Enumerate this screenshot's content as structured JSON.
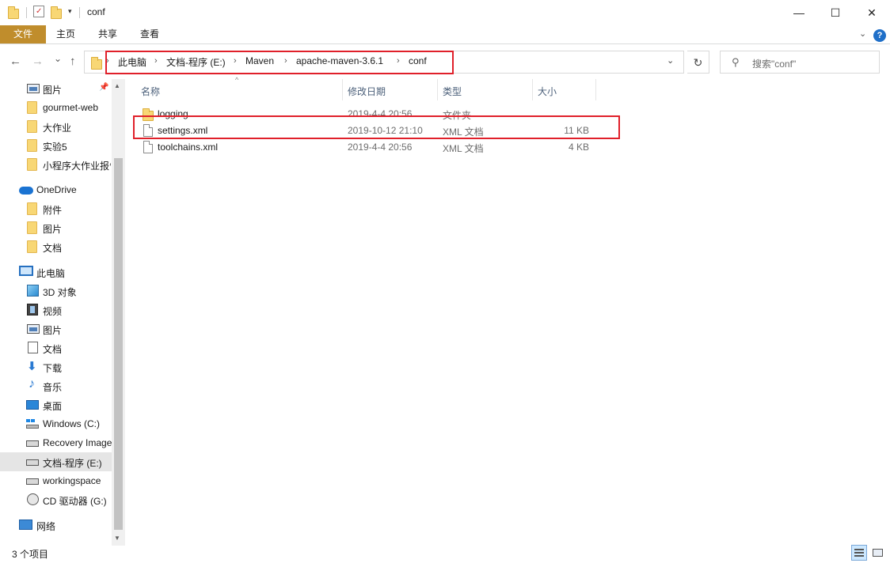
{
  "window": {
    "title": "conf",
    "minimize": "—",
    "maximize": "☐",
    "close": "✕"
  },
  "ribbon": {
    "tabs": [
      "文件",
      "主页",
      "共享",
      "查看"
    ],
    "expand_icon": "chevron-down-icon",
    "help": "?"
  },
  "nav": {
    "back": "←",
    "forward": "→",
    "recent": "⌄",
    "up": "↑",
    "breadcrumbs": [
      "此电脑",
      "文档-程序 (E:)",
      "Maven",
      "apache-maven-3.6.1",
      "conf"
    ],
    "separator": "›",
    "refresh": "↻",
    "search_placeholder": "搜索\"conf\""
  },
  "sidebar": {
    "quick_access": [
      {
        "label": "图片",
        "icon": "pictures-icon",
        "pinned": true
      },
      {
        "label": "gourmet-web",
        "icon": "folder-icon"
      },
      {
        "label": "大作业",
        "icon": "folder-icon"
      },
      {
        "label": "实验5",
        "icon": "folder-icon"
      },
      {
        "label": "小程序大作业报告",
        "icon": "folder-icon"
      }
    ],
    "onedrive": {
      "label": "OneDrive",
      "items": [
        {
          "label": "附件",
          "icon": "folder-icon"
        },
        {
          "label": "图片",
          "icon": "folder-icon"
        },
        {
          "label": "文档",
          "icon": "folder-icon"
        }
      ]
    },
    "this_pc": {
      "label": "此电脑",
      "items": [
        {
          "label": "3D 对象",
          "icon": "3d-objects-icon"
        },
        {
          "label": "视频",
          "icon": "videos-icon"
        },
        {
          "label": "图片",
          "icon": "pictures-icon"
        },
        {
          "label": "文档",
          "icon": "documents-icon"
        },
        {
          "label": "下载",
          "icon": "downloads-icon"
        },
        {
          "label": "音乐",
          "icon": "music-icon"
        },
        {
          "label": "桌面",
          "icon": "desktop-icon"
        },
        {
          "label": "Windows (C:)",
          "icon": "windows-drive-icon"
        },
        {
          "label": "Recovery Image",
          "icon": "drive-icon"
        },
        {
          "label": "文档-程序 (E:)",
          "icon": "drive-icon",
          "selected": true
        },
        {
          "label": "workingspace",
          "icon": "drive-icon"
        },
        {
          "label": "CD 驱动器 (G:)",
          "icon": "cd-drive-icon"
        }
      ]
    },
    "network": {
      "label": "网络",
      "icon": "network-icon"
    }
  },
  "columns": {
    "name": "名称",
    "modified": "修改日期",
    "type": "类型",
    "size": "大小"
  },
  "files": [
    {
      "name": "logging",
      "modified": "2019-4-4 20:56",
      "type": "文件夹",
      "size": "",
      "icon": "folder-icon"
    },
    {
      "name": "settings.xml",
      "modified": "2019-10-12 21:10",
      "type": "XML 文档",
      "size": "11 KB",
      "icon": "file-icon"
    },
    {
      "name": "toolchains.xml",
      "modified": "2019-4-4 20:56",
      "type": "XML 文档",
      "size": "4 KB",
      "icon": "file-icon"
    }
  ],
  "status": {
    "item_count": "3 个项目"
  },
  "colors": {
    "file_tab": "#c08d2c",
    "highlight": "#e0202a",
    "accent": "#1f6fc8"
  }
}
